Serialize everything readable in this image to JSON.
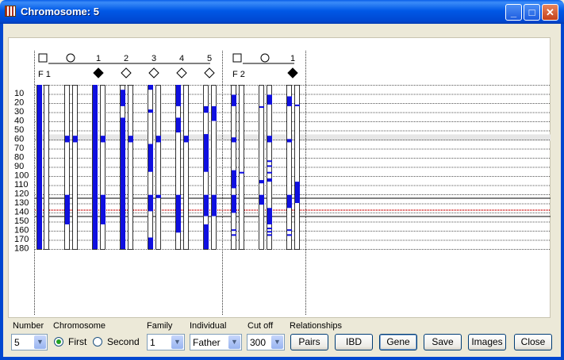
{
  "window": {
    "title": "Chromosome: 5",
    "min_glyph": "_",
    "max_glyph": "□",
    "close_glyph": "✕"
  },
  "chart": {
    "rows": [
      "10",
      "20",
      "30",
      "40",
      "50",
      "60",
      "70",
      "80",
      "90",
      "100",
      "110",
      "120",
      "130",
      "140",
      "150",
      "160",
      "170",
      "180"
    ],
    "families": [
      {
        "label": "F 1",
        "individuals": [
          "",
          "",
          "1",
          "2",
          "3",
          "4",
          "5"
        ]
      },
      {
        "label": "F 2",
        "individuals": [
          "",
          "",
          "1"
        ]
      }
    ]
  },
  "controls": {
    "number_label": "Number",
    "number_value": "5",
    "chromosome_label": "Chromosome",
    "first_label": "First",
    "second_label": "Second",
    "selected": "First",
    "family_label": "Family",
    "family_value": "1",
    "individual_label": "Individual",
    "individual_value": "Father",
    "cutoff_label": "Cut off",
    "cutoff_value": "300",
    "relationships_label": "Relationships",
    "pairs_label": "Pairs",
    "ibd_label": "IBD",
    "gene_label": "Gene",
    "save_label": "Save",
    "images_label": "Images",
    "close_label": "Close"
  },
  "colors": {
    "haplotype": "#1010e0",
    "title_bar": "#0058e6",
    "marker_line": "#cc0000"
  }
}
